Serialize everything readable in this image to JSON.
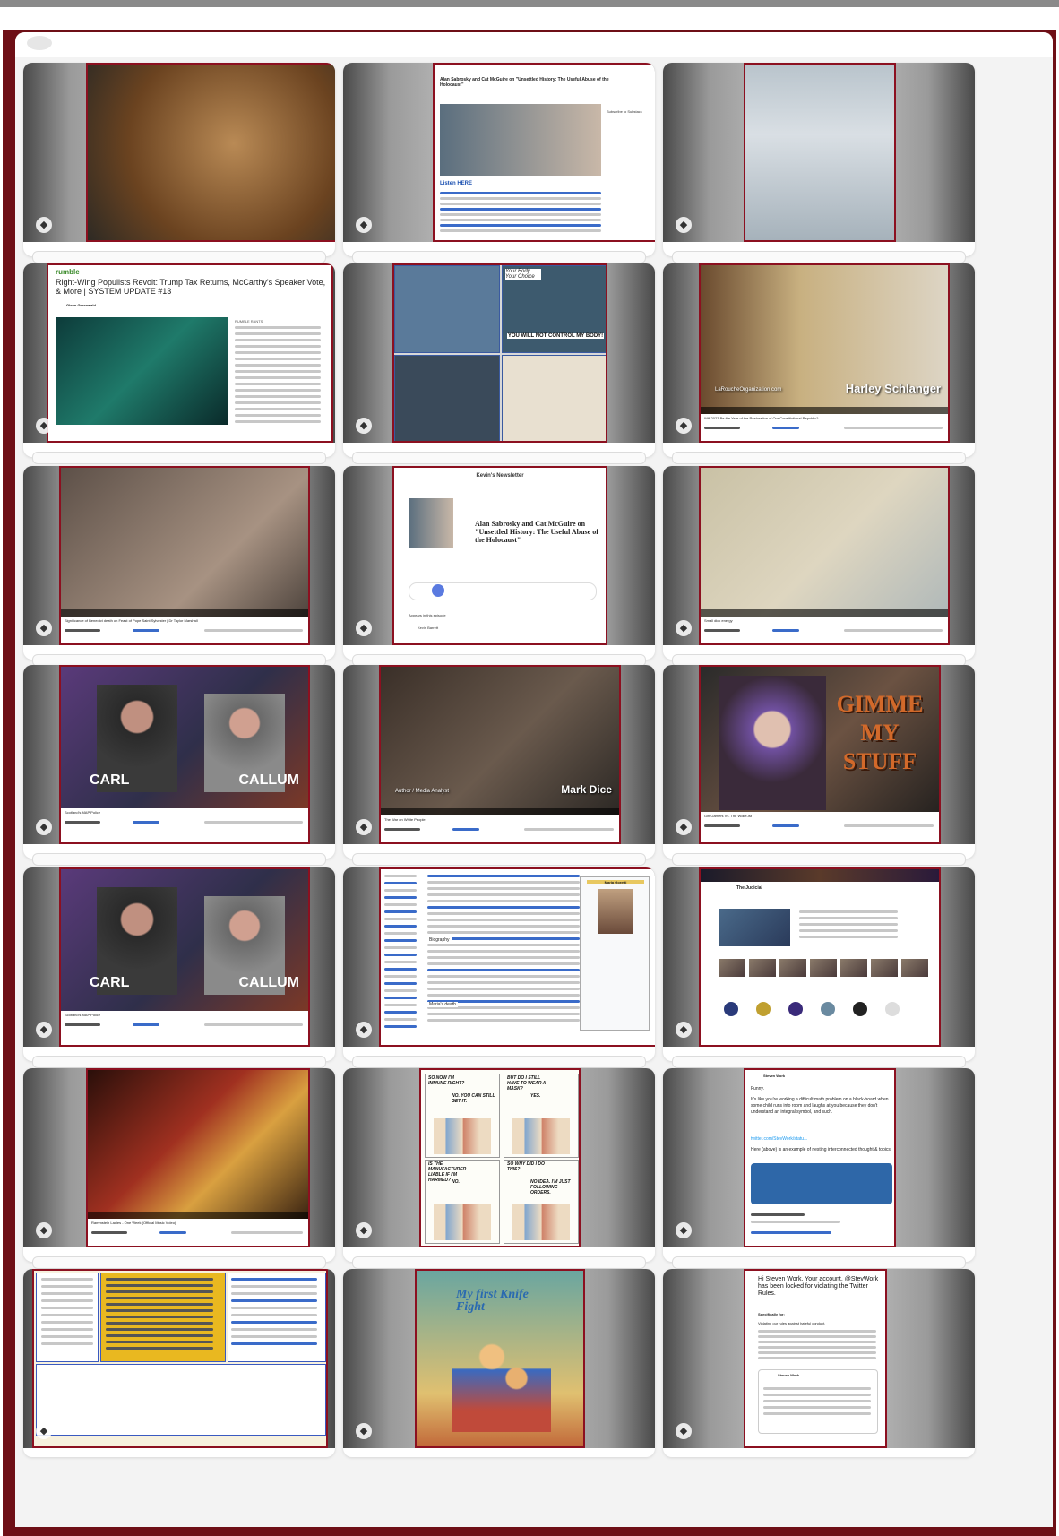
{
  "tag_icon": "tag-icon",
  "cards": [
    {
      "id": "c1",
      "theme": "t-bronze",
      "kind": "photo",
      "title": "",
      "sub": ""
    },
    {
      "id": "c2",
      "theme": "t-doc",
      "kind": "doc",
      "title": "Alan Sabrosky and Cat McGuire on \"Unsettled History: The Useful Abuse of the Holocaust\"",
      "sub": "Listen HERE",
      "extra": "Subscribe to Substack"
    },
    {
      "id": "c3",
      "theme": "t-statue",
      "kind": "photo",
      "title": "",
      "sub": ""
    },
    {
      "id": "c4",
      "theme": "t-rumble",
      "kind": "rumble",
      "brand": "rumble",
      "title": "Right-Wing Populists Revolt: Trump Tax Returns, McCarthy's Speaker Vote, & More | SYSTEM UPDATE #13",
      "sub": "Glenn Greenwald",
      "side": "RUMBLE RANTS"
    },
    {
      "id": "c5",
      "theme": "t-comic",
      "kind": "comic",
      "title": "Your Body Your Choice",
      "sub": "YOU WILL NOT CONTROL MY BODY!"
    },
    {
      "id": "c6",
      "theme": "t-library",
      "kind": "video",
      "title": "Harley Schlanger",
      "sub": "LaRoucheOrganization.com",
      "caption": "Will 2023 Be the Year of the Restoration of Our Constitutional Republic?"
    },
    {
      "id": "c7",
      "theme": "t-room",
      "kind": "video",
      "title": "",
      "sub": "",
      "caption": "Significance of Benedict death on Feast of Pope Saint Sylvester | Dr Taylor Marshall"
    },
    {
      "id": "c8",
      "theme": "t-news",
      "kind": "newsletter",
      "title": "Kevin's Newsletter",
      "sub": "Alan Sabrosky and Cat McGuire on \"Unsettled History: The Useful Abuse of the Holocaust\"",
      "extra": "Appears in this episode",
      "author": "Kevin Barrett"
    },
    {
      "id": "c9",
      "theme": "t-map",
      "kind": "video",
      "title": "",
      "sub": "",
      "caption": "Small dick energy"
    },
    {
      "id": "c10",
      "theme": "t-pod",
      "kind": "podcast",
      "title": "CARL",
      "sub": "CALLUM",
      "caption": "Scotland's MAP Police"
    },
    {
      "id": "c11",
      "theme": "t-dark",
      "kind": "video",
      "title": "Mark Dice",
      "sub": "Author / Media Analyst",
      "caption": "The War on White People"
    },
    {
      "id": "c12",
      "theme": "t-game",
      "kind": "game",
      "title": "GIMME MY STUFF",
      "sub": "",
      "caption": "Girl Gamers Vs. The Woke-ist"
    },
    {
      "id": "c13",
      "theme": "t-pod",
      "kind": "podcast",
      "title": "CARL",
      "sub": "CALLUM",
      "caption": "Scotland's MAP Police"
    },
    {
      "id": "c14",
      "theme": "t-wiki",
      "kind": "wiki",
      "title": "Maria Goretti",
      "sub": "Biography",
      "extra": "Maria's death"
    },
    {
      "id": "c15",
      "theme": "t-twitter",
      "kind": "profile",
      "title": "The Judicial",
      "sub": ""
    },
    {
      "id": "c16",
      "theme": "t-opera",
      "kind": "video",
      "title": "",
      "sub": "",
      "caption": "Rammstein Ladies - One Week (Official Music Video)"
    },
    {
      "id": "c17",
      "theme": "t-ink",
      "kind": "inkcomic",
      "title": "SO NOW I'M IMMUNE RIGHT?",
      "sub": "NO. YOU CAN STILL GET IT.",
      "q2": "BUT DO I STILL HAVE TO WEAR A MASK?",
      "a2": "YES.",
      "q3": "IS THE MANUFACTURER LIABLE IF I'M HARMED?",
      "a3": "NO.",
      "q4": "SO WHY DID I DO THIS?",
      "a4": "NO IDEA. I'M JUST FOLLOWING ORDERS."
    },
    {
      "id": "c18",
      "theme": "t-tweet",
      "kind": "tweet",
      "title": "Steven Work",
      "sub": "Funny.",
      "body": "It's like you're working a difficult math problem on a black-board when some child runs into room and laughs at you because they don't understand an integral symbol, and such.",
      "link": "twitter.com/StevWork/statu...",
      "body2": "Here (above) is an example of nesting interconnected thought & topics."
    },
    {
      "id": "c19",
      "theme": "t-collage",
      "kind": "collage",
      "title": "",
      "sub": ""
    },
    {
      "id": "c20",
      "theme": "t-knife",
      "kind": "knife",
      "title": "My first Knife Fight",
      "sub": ""
    },
    {
      "id": "c21",
      "theme": "t-notice",
      "kind": "notice",
      "title": "Hi Steven Work, Your account, @StevWork has been locked for violating the Twitter Rules.",
      "sub": "Specifically for:",
      "body": "Violating our rules against hateful conduct.",
      "author": "Steven Work"
    }
  ]
}
